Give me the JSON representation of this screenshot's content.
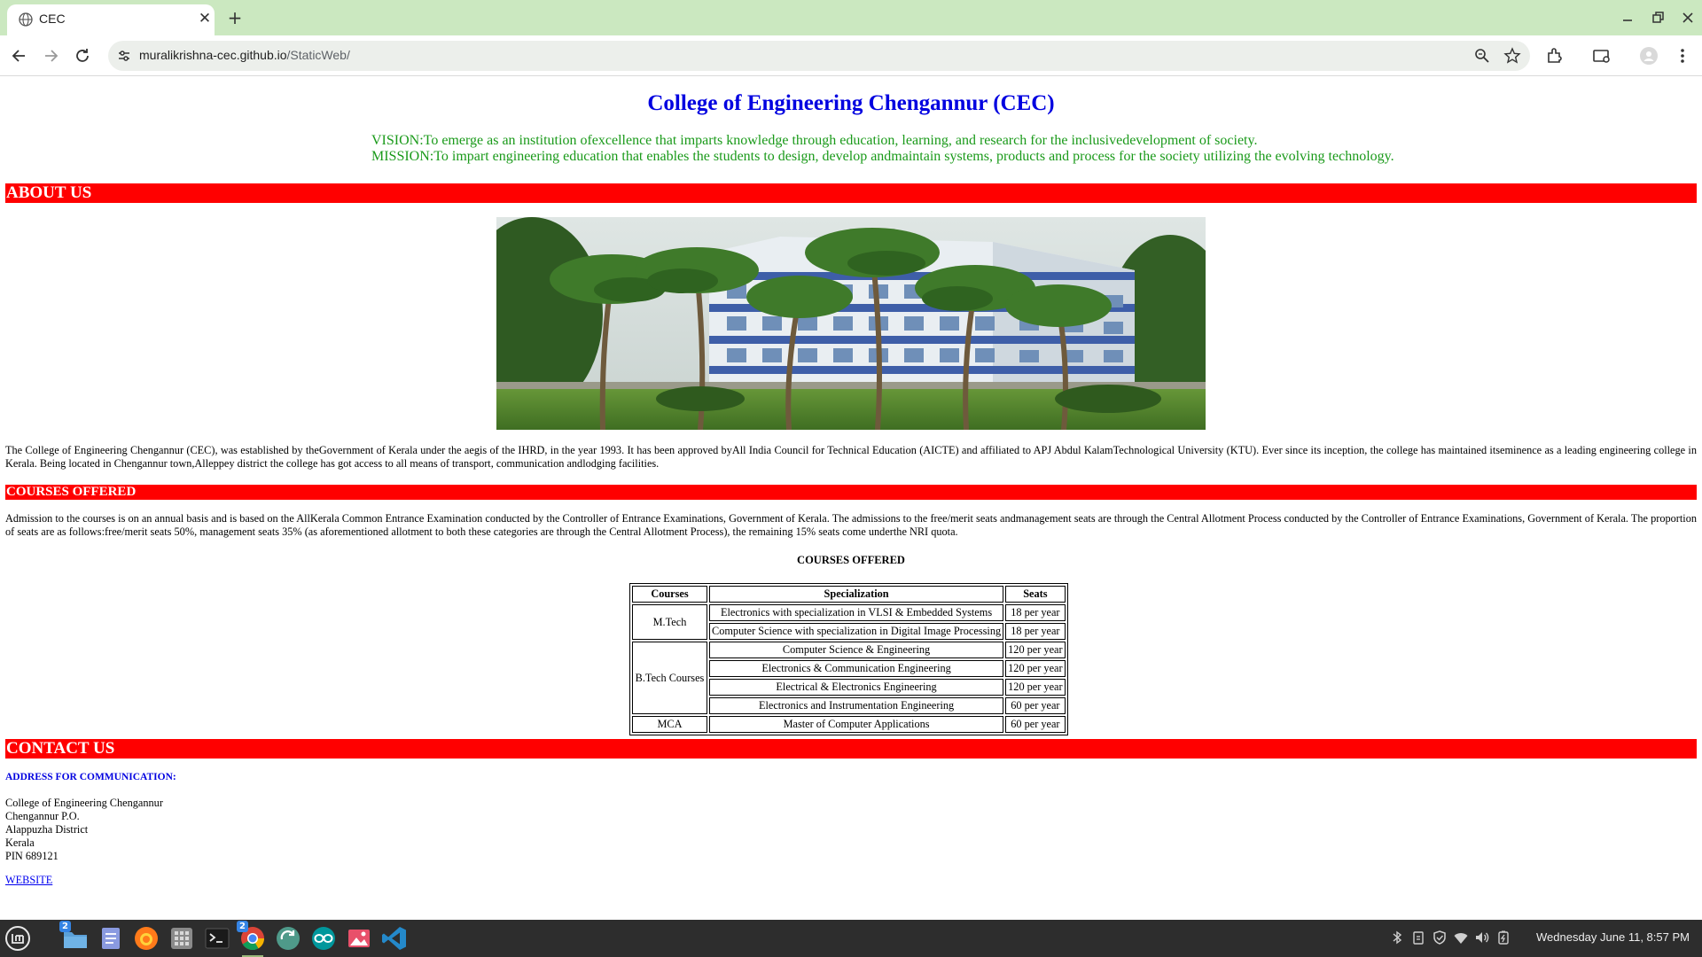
{
  "browser": {
    "tab_title": "CEC",
    "url_host": "muralikrishna-cec.github.io",
    "url_path": "/StaticWeb/"
  },
  "page": {
    "title": "College of Engineering Chengannur (CEC)",
    "vision": "VISION:To emerge as an institution ofexcellence that imparts knowledge through education, learning, and research for the inclusivedevelopment of society.",
    "mission": "MISSION:To impart engineering education that enables the students to design, develop andmaintain systems, products and process for the society utilizing the evolving technology.",
    "about_heading": "ABOUT US",
    "about_text": "The College of Engineering Chengannur (CEC), was established by theGovernment of Kerala under the aegis of the IHRD, in the year 1993. It has been approved byAll India Council for Technical Education (AICTE) and affiliated to APJ Abdul KalamTechnological University (KTU). Ever since its inception, the college has maintained itseminence as a leading engineering college in Kerala. Being located in Chengannur town,Alleppey district the college has got access to all means of transport, communication andlodging facilities.",
    "courses_heading": "COURSES OFFERED",
    "admission_text": "Admission to the courses is on an annual basis and is based on the AllKerala Common Entrance Examination conducted by the Controller of Entrance Examinations, Government of Kerala. The admissions to the free/merit seats andmanagement seats are through the Central Allotment Process conducted by the Controller of Entrance Examinations, Government of Kerala. The proportion of seats are as follows:free/merit seats 50%, management seats 35% (as aforementioned allotment to both these categories are through the Central Allotment Process), the remaining 15% seats come underthe NRI quota.",
    "table_caption": "COURSES OFFERED",
    "table": {
      "headers": [
        "Courses",
        "Specialization",
        "Seats"
      ],
      "groups": [
        {
          "course": "M.Tech",
          "rows": [
            {
              "spec": "Electronics with specialization in VLSI & Embedded Systems",
              "seats": "18 per year"
            },
            {
              "spec": "Computer Science with specialization in Digital Image Processing",
              "seats": "18 per year"
            }
          ]
        },
        {
          "course": "B.Tech Courses",
          "rows": [
            {
              "spec": "Computer Science & Engineering",
              "seats": "120 per year"
            },
            {
              "spec": "Electronics & Communication Engineering",
              "seats": "120 per year"
            },
            {
              "spec": "Electrical & Electronics Engineering",
              "seats": "120 per year"
            },
            {
              "spec": "Electronics and Instrumentation Engineering",
              "seats": "60 per year"
            }
          ]
        },
        {
          "course": "MCA",
          "rows": [
            {
              "spec": "Master of Computer Applications",
              "seats": "60 per year"
            }
          ]
        }
      ]
    },
    "contact_heading": "CONTACT US",
    "address_heading": "ADDRESS FOR COMMUNICATION:",
    "address_lines": [
      "College of Engineering Chengannur",
      "Chengannur P.O.",
      "Alappuzha District",
      "Kerala",
      "PIN 689121"
    ],
    "website_link": "WEBSITE"
  },
  "taskbar": {
    "files_badge": "2",
    "chrome_badge": "2",
    "clock": "Wednesday June 11, 8:57 PM"
  },
  "colors": {
    "tabbar": "#cbe8c0",
    "section_bar": "#ff0000",
    "title_blue": "#0000e0",
    "vision_green": "#1a9a1a",
    "taskbar": "#2d2d2d"
  }
}
